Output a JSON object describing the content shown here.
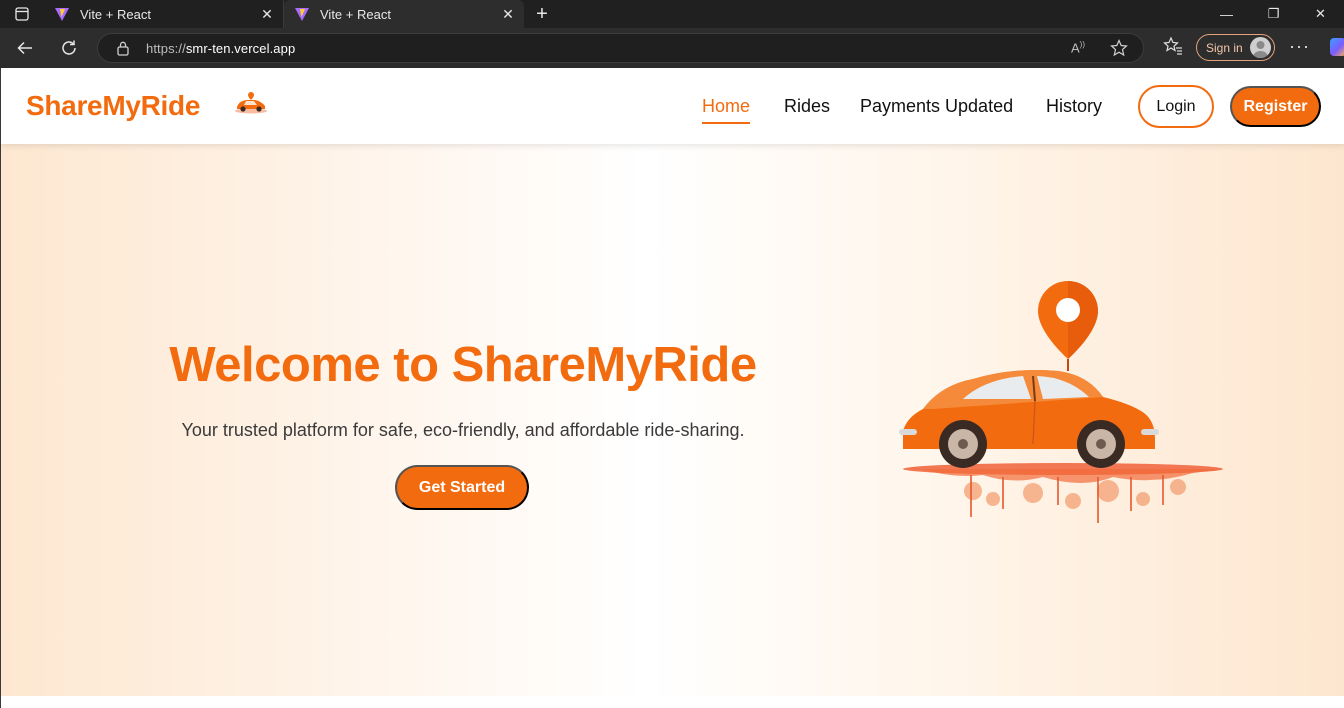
{
  "browser": {
    "tabs": [
      {
        "title": "Vite + React",
        "active": false
      },
      {
        "title": "Vite + React",
        "active": true
      }
    ],
    "url_scheme": "https://",
    "url_host": "smr-ten.vercel.app",
    "signin_label": "Sign in",
    "icons": [
      "tab-actions-icon",
      "vite-favicon-icon",
      "close-icon",
      "plus-icon",
      "minimize-icon",
      "restore-icon",
      "window-close-icon",
      "back-arrow-icon",
      "refresh-icon",
      "lock-icon",
      "read-aloud-icon",
      "star-icon",
      "favorites-icon",
      "avatar-icon",
      "more-icon",
      "copilot-icon"
    ]
  },
  "site": {
    "brand": "ShareMyRide",
    "nav": [
      {
        "label": "Home",
        "active": true
      },
      {
        "label": "Rides",
        "active": false
      },
      {
        "label": "Payments Updated",
        "active": false
      },
      {
        "label": "History",
        "active": false
      }
    ],
    "login_label": "Login",
    "register_label": "Register",
    "accent_color": "#f26b0f"
  },
  "hero": {
    "title": "Welcome to ShareMyRide",
    "subtitle": "Your trusted platform for safe, eco-friendly, and affordable ride-sharing.",
    "cta_label": "Get Started",
    "image_alt_icon": "car-with-location-pin-illustration"
  }
}
